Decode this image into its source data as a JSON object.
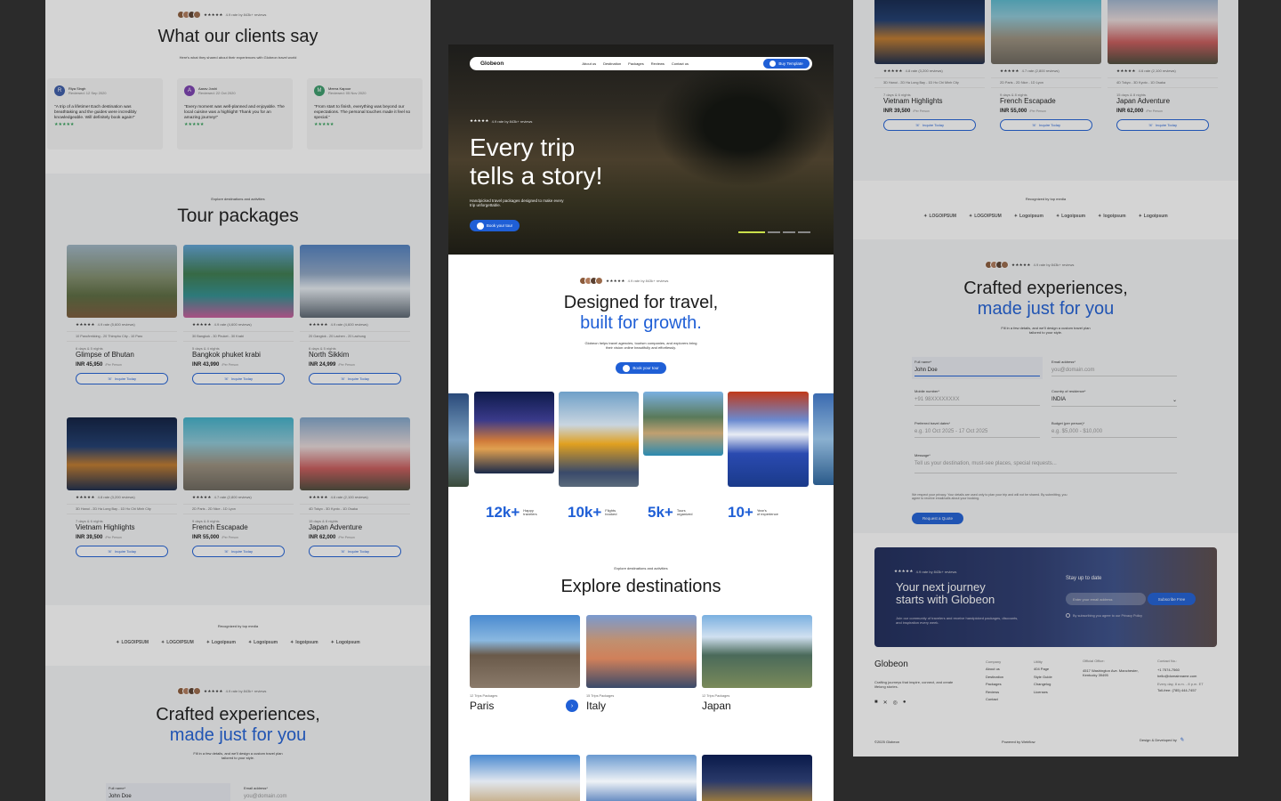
{
  "rating_text": "4.9 rate by 843k+ reviews",
  "left": {
    "testimonials": {
      "title": "What our clients say",
      "subtitle": "Here's what they shared about their experiences with Globeon travel world",
      "items": [
        {
          "initial": "R",
          "name": "Riya Singh",
          "date": "Reviewed: 12 Sep 2020",
          "quote": "\"A trip of a lifetime! Each destination was breathtaking and the guides were incredibly knowledgeable. Will definitely book again!\"",
          "color": "#3a5ba8"
        },
        {
          "initial": "A",
          "name": "Aarav Joshi",
          "date": "Reviewed: 22 Oct 2020",
          "quote": "\"Every moment was well-planned and enjoyable. The local cuisine was a highlight! Thank you for an amazing journey!\"",
          "color": "#7a3fb0"
        },
        {
          "initial": "M",
          "name": "Meera Kapoor",
          "date": "Reviewed: 05 Nov 2020",
          "quote": "\"From start to finish, everything was beyond our expectations. The personal touches made it feel so special.\"",
          "color": "#3a9b6b"
        }
      ]
    },
    "tours": {
      "eyebrow": "Explore destinations and activities",
      "title": "Tour packages"
    },
    "media_label": "Recognized by top media",
    "crafted": {
      "line1": "Crafted experiences,",
      "line2": "made just for you",
      "sub": "Fill in a few details, and we'll design a custom travel plan tailored to your style.",
      "fullname_label": "Full name*",
      "fullname_value": "John Doe",
      "email_label": "Email address*",
      "email_placeholder": "you@domain.com"
    }
  },
  "packages": [
    {
      "rating": "4.9 rate (5,600 reviews)",
      "route": "10 Paro/trekking - 20 Thimphu City - 10 Paro",
      "days": "6 days & 5 nights",
      "name": "Glimpse of Bhutan",
      "price": "INR 45,950",
      "img": "linear-gradient(180deg,#9fb5c5 0%,#7f8c6b 45%,#5a6a3f 70%,#7a5a3a 100%)"
    },
    {
      "rating": "4.9 rate (4,600 reviews)",
      "route": "30 Bangkok - 30 Phuket - 30 Krabi",
      "days": "5 days & 4 nights",
      "name": "Bangkok phuket krabi",
      "price": "INR 43,990",
      "img": "linear-gradient(180deg,#5fa3d6 0%,#3b7a4d 40%,#2f8f8f 70%,#c85a9a 100%)"
    },
    {
      "rating": "4.9 rate (4,600 reviews)",
      "route": "20 Gangtok - 20 Lachen - 20 Lachung",
      "days": "6 days & 5 nights",
      "name": "North Sikkim",
      "price": "INR 24,999",
      "img": "linear-gradient(180deg,#4f7fc0 0%,#8fa6c4 40%,#e6ecf2 60%,#5a6570 100%)"
    },
    {
      "rating": "4.8 rate (3,200 reviews)",
      "route": "3D Hanoi - 2D Ha Long Bay - 1D Ho Chi Minh City",
      "days": "7 days & 6 nights",
      "name": "Vietnam Highlights",
      "price": "INR 39,500",
      "img": "linear-gradient(180deg,#0d1d3f 0%,#1d3b6e 40%,#c07a2c 65%,#1a2a4a 100%)"
    },
    {
      "rating": "4.7 rate (2,800 reviews)",
      "route": "2D Paris - 2D Nice - 1D Lyon",
      "days": "9 days & 8 nights",
      "name": "French Escapade",
      "price": "INR 55,000",
      "img": "linear-gradient(180deg,#3fb0c9 0%,#8dc7d6 35%,#9a8f7d 65%,#6b665c 100%)"
    },
    {
      "rating": "4.6 rate (2,100 reviews)",
      "route": "4D Tokyo - 3D Kyoto - 1D Osaka",
      "days": "15 days & 8 nights",
      "name": "Japan Adventure",
      "price": "INR 62,000",
      "img": "linear-gradient(180deg,#7fa4c9 0%,#e8d9d9 40%,#c85a5a 70%,#4a4a3a 100%)"
    }
  ],
  "per_person": "/Per Person",
  "enquire": "Inquire Today",
  "center": {
    "nav": {
      "brand": "Globeon",
      "links": [
        "About us",
        "Destination",
        "Packages",
        "Reviews",
        "Contact us"
      ],
      "cta": "Buy Template"
    },
    "hero": {
      "line1": "Every trip",
      "line2": "tells a story!",
      "sub": "Handpicked travel packages designed to make every trip unforgettable.",
      "cta": "Book your tour"
    },
    "intro": {
      "line1": "Designed for travel,",
      "line2": "built for growth.",
      "sub": "Globeon helps travel agencies, tourism companies, and explorers bring their vision online beautifully and effortlessly.",
      "cta": "Book your tour"
    },
    "stats": [
      {
        "num": "12k+",
        "l1": "Happy",
        "l2": "travelers"
      },
      {
        "num": "10k+",
        "l1": "Flights",
        "l2": "booked"
      },
      {
        "num": "5k+",
        "l1": "Tours",
        "l2": "organized"
      },
      {
        "num": "10+",
        "l1": "Year's",
        "l2": "of experience"
      }
    ],
    "explore": {
      "eyebrow": "Explore destinations and activities",
      "title": "Explore destinations",
      "items": [
        {
          "count": "12 Trips Packages",
          "name": "Paris"
        },
        {
          "count": "15 Trips Packages",
          "name": "Italy"
        },
        {
          "count": "12 Trips Packages",
          "name": "Japan"
        }
      ]
    }
  },
  "right": {
    "media_label": "Recognized by top media",
    "crafted": {
      "line1": "Crafted experiences,",
      "line2": "made just for you",
      "sub": "Fill in a few details, and we'll design a custom travel plan tailored to your style.",
      "fullname_label": "Full name*",
      "fullname_value": "John Doe",
      "email_label": "Email address*",
      "email_placeholder": "you@domain.com",
      "mobile_label": "Mobile number*",
      "mobile_placeholder": "+91 98XXXXXXXX",
      "country_label": "Country of residence*",
      "country_value": "INDIA",
      "dates_label": "Preferred travel dates*",
      "dates_placeholder": "e.g. 10 Oct 2025 - 17 Oct 2025",
      "budget_label": "Budget (per person)*",
      "budget_placeholder": "e.g. $5,000 - $10,000",
      "message_label": "Message*",
      "message_placeholder": "Tell us your destination, must-see places, special requests...",
      "privacy": "We respect your privacy. Your details are used only to plan your trip and will not be shared. By submitting, you agree to receive email/calls about your booking.",
      "cta": "Request a Quote"
    },
    "newsletter": {
      "line1": "Your next journey",
      "line2": "starts with Globeon",
      "sub": "Join our community of travelers and receive handpicked packages, discounts, and inspiration every week.",
      "stay": "Stay up to date",
      "placeholder": "Enter your email address",
      "cta": "Subscribe Free",
      "consent": "By subscribing you agree to our Privacy Policy"
    },
    "footer": {
      "brand": "Globeon",
      "tagline": "Crafting journeys that inspire, connect, and create lifelong stories.",
      "company_h": "Company",
      "company": [
        "About us",
        "Destination",
        "Packages",
        "Reviews",
        "Contact"
      ],
      "utility_h": "Utility",
      "utility": [
        "404 Page",
        "Style Guide",
        "Changelog",
        "Licenses"
      ],
      "office_h": "Official Office:",
      "office": "4517 Washington Ave. Manchester, Kentucky 39495",
      "contact_h": "Contact No.:",
      "phone": "+1 7574-7560",
      "email": "hello@domainname.com",
      "hours": "Every day, 8 a.m. - 8 p.m. ET",
      "tollfree": "Toll-free: (785) 444-7457",
      "copyright": "©2025 Globeon",
      "powered": "Powered by Webflow",
      "design": "Design & Developed by"
    }
  },
  "logos": [
    "LOGOIPSUM",
    "LOGOIPSUM",
    "Logoipsum",
    "Logoipsum",
    "logoipsum",
    "Logoipsum"
  ]
}
